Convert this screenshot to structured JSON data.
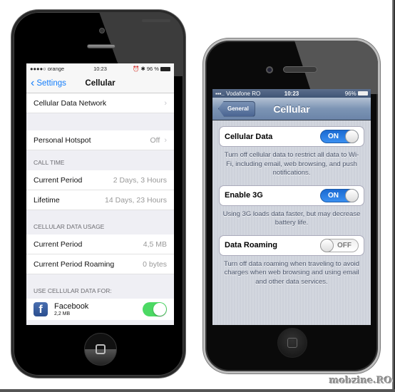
{
  "ios7": {
    "status": {
      "carrier": "●●●●○ orange",
      "wifi": "wifi",
      "time": "10:23",
      "right": "⏰ ✱ 96 %",
      "battery_percent": 96
    },
    "nav": {
      "back_label": "Settings",
      "title": "Cellular"
    },
    "rows_top": [
      {
        "label": "Cellular Data Network",
        "value": ""
      }
    ],
    "hotspot": {
      "label": "Personal Hotspot",
      "value": "Off"
    },
    "call_time": {
      "header": "CALL TIME",
      "rows": [
        {
          "label": "Current Period",
          "value": "2 Days, 3 Hours"
        },
        {
          "label": "Lifetime",
          "value": "14 Days, 23 Hours"
        }
      ]
    },
    "data_usage": {
      "header": "CELLULAR DATA USAGE",
      "rows": [
        {
          "label": "Current Period",
          "value": "4,5 MB"
        },
        {
          "label": "Current Period Roaming",
          "value": "0 bytes"
        }
      ]
    },
    "use_for": {
      "header": "USE CELLULAR DATA FOR:",
      "apps": [
        {
          "name": "Facebook",
          "size": "2,2 MB",
          "enabled": true,
          "icon_letter": "f"
        }
      ]
    }
  },
  "ios6": {
    "status": {
      "carrier": "▪▪▪.. Vodafone RO",
      "time": "10:23",
      "battery": "96%",
      "battery_percent": 96
    },
    "nav": {
      "back_label": "General",
      "title": "Cellular"
    },
    "settings": [
      {
        "label": "Cellular Data",
        "state": "ON",
        "enabled": true,
        "note": "Turn off cellular data to restrict all data to Wi-Fi, including email, web browsing, and push notifications."
      },
      {
        "label": "Enable 3G",
        "state": "ON",
        "enabled": true,
        "note": "Using 3G loads data faster, but may decrease battery life."
      },
      {
        "label": "Data Roaming",
        "state": "OFF",
        "enabled": false,
        "note": "Turn off data roaming when traveling to avoid charges when web browsing and using email and other data services."
      }
    ]
  },
  "watermark": "mobzine.RO",
  "colors": {
    "ios7_blue": "#147efb",
    "ios7_green": "#4cd964",
    "ios6_blue": "#1a6ad2",
    "ios6_nav": "#6b84a8",
    "facebook": "#3b5998"
  }
}
